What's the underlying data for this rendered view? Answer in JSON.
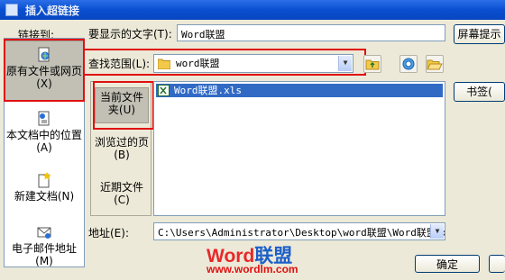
{
  "window": {
    "title": "插入超链接"
  },
  "link_to": {
    "label": "链接到:",
    "items": [
      {
        "label": "原有文件或网页(X)",
        "icon": "web-page-icon",
        "selected": true
      },
      {
        "label": "本文档中的位置(A)",
        "icon": "document-place-icon",
        "selected": false
      },
      {
        "label": "新建文档(N)",
        "icon": "new-document-icon",
        "selected": false
      },
      {
        "label": "电子邮件地址(M)",
        "icon": "email-icon",
        "selected": false
      }
    ]
  },
  "display_text": {
    "label": "要显示的文字(T):",
    "value": "Word联盟"
  },
  "screen_tip_button": "屏幕提示",
  "look_in": {
    "label": "查找范围(L):",
    "value": "word联盟"
  },
  "look_panel": {
    "items": [
      {
        "label": "当前文件夹(U)",
        "selected": true
      },
      {
        "label": "浏览过的页(B)",
        "selected": false
      },
      {
        "label": "近期文件(C)",
        "selected": false
      }
    ]
  },
  "files": [
    {
      "name": "Word联盟.xls",
      "selected": true
    }
  ],
  "bookmark_button": "书签(",
  "address": {
    "label": "地址(E):",
    "value": "C:\\Users\\Administrator\\Desktop\\word联盟\\Word联盟.xls"
  },
  "ok_button": "确定",
  "watermark": {
    "brand_red": "Word",
    "brand_blue": "联盟",
    "url": "www.wordlm.com"
  },
  "colors": {
    "highlight": "#e01010",
    "selection": "#316ac5",
    "dialog": "#ece9d8"
  }
}
